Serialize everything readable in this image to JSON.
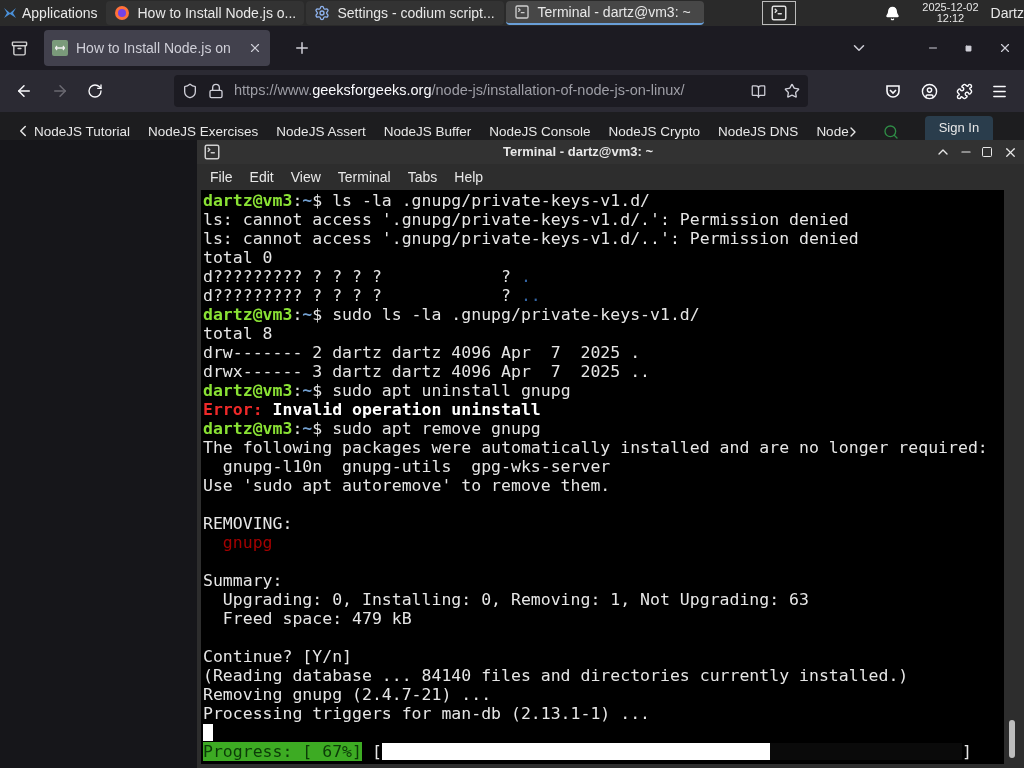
{
  "panel": {
    "apps_label": "Applications",
    "tasks": [
      {
        "kind": "browser",
        "title": "How to Install Node.js o...",
        "selected": false
      },
      {
        "kind": "settings",
        "title": "Settings - codium script...",
        "selected": false
      },
      {
        "kind": "terminal",
        "title": "Terminal - dartz@vm3: ~",
        "selected": true
      }
    ],
    "clock_date": "2025-12-02",
    "clock_time": "12:12",
    "user": "Dartz"
  },
  "browser": {
    "tab": {
      "title": "How to Install Node.js on"
    },
    "url": {
      "prefix": "https://www.",
      "domain": "geeksforgeeks.org",
      "path": "/node-js/installation-of-node-js-on-linux/"
    },
    "forward_disabled": true,
    "nav_links": [
      "NodeJS Tutorial",
      "NodeJS Exercises",
      "NodeJS Assert",
      "NodeJS Buffer",
      "NodeJS Console",
      "NodeJS Crypto",
      "NodeJS DNS",
      "Node"
    ],
    "sign_in": "Sign In"
  },
  "terminal": {
    "title": "Terminal - dartz@vm3: ~",
    "menu": [
      "File",
      "Edit",
      "View",
      "Terminal",
      "Tabs",
      "Help"
    ],
    "lines": [
      {
        "kind": "prompt",
        "user": "dartz@vm3",
        "sep": ":",
        "path": "~",
        "command": "$ ls -la .gnupg/private-keys-v1.d/"
      },
      {
        "kind": "text",
        "segments": [
          {
            "kind": "plain",
            "text": "ls: cannot access '.gnupg/private-keys-v1.d/.': Permission denied"
          }
        ]
      },
      {
        "kind": "text",
        "segments": [
          {
            "kind": "plain",
            "text": "ls: cannot access '.gnupg/private-keys-v1.d/..': Permission denied"
          }
        ]
      },
      {
        "kind": "text",
        "segments": [
          {
            "kind": "plain",
            "text": "total 0"
          }
        ]
      },
      {
        "kind": "text",
        "segments": [
          {
            "kind": "plain",
            "text": "d????????? ? ? ? ?            ? "
          },
          {
            "kind": "dir",
            "text": "."
          }
        ]
      },
      {
        "kind": "text",
        "segments": [
          {
            "kind": "plain",
            "text": "d????????? ? ? ? ?            ? "
          },
          {
            "kind": "dir",
            "text": ".."
          }
        ]
      },
      {
        "kind": "prompt",
        "user": "dartz@vm3",
        "sep": ":",
        "path": "~",
        "command": "$ sudo ls -la .gnupg/private-keys-v1.d/"
      },
      {
        "kind": "text",
        "segments": [
          {
            "kind": "plain",
            "text": "total 8"
          }
        ]
      },
      {
        "kind": "text",
        "segments": [
          {
            "kind": "plain",
            "text": "drw------- 2 dartz dartz 4096 Apr  7  2025 ."
          }
        ]
      },
      {
        "kind": "text",
        "segments": [
          {
            "kind": "plain",
            "text": "drwx------ 3 dartz dartz 4096 Apr  7  2025 .."
          }
        ]
      },
      {
        "kind": "prompt",
        "user": "dartz@vm3",
        "sep": ":",
        "path": "~",
        "command": "$ sudo apt uninstall gnupg"
      },
      {
        "kind": "text",
        "segments": [
          {
            "kind": "error",
            "text": "Error:"
          },
          {
            "kind": "bold",
            "text": " Invalid operation uninstall"
          }
        ]
      },
      {
        "kind": "prompt",
        "user": "dartz@vm3",
        "sep": ":",
        "path": "~",
        "command": "$ sudo apt remove gnupg"
      },
      {
        "kind": "text",
        "segments": [
          {
            "kind": "plain",
            "text": "The following packages were automatically installed and are no longer required:"
          }
        ]
      },
      {
        "kind": "text",
        "segments": [
          {
            "kind": "plain",
            "text": "  gnupg-l10n  gnupg-utils  gpg-wks-server"
          }
        ]
      },
      {
        "kind": "text",
        "segments": [
          {
            "kind": "plain",
            "text": "Use 'sudo apt autoremove' to remove them."
          }
        ]
      },
      {
        "kind": "blank"
      },
      {
        "kind": "text",
        "segments": [
          {
            "kind": "plain",
            "text": "REMOVING:"
          }
        ]
      },
      {
        "kind": "text",
        "segments": [
          {
            "kind": "removed",
            "text": "  gnupg"
          }
        ]
      },
      {
        "kind": "blank"
      },
      {
        "kind": "text",
        "segments": [
          {
            "kind": "plain",
            "text": "Summary:"
          }
        ]
      },
      {
        "kind": "text",
        "segments": [
          {
            "kind": "plain",
            "text": "  Upgrading: 0, Installing: 0, Removing: 1, Not Upgrading: 63"
          }
        ]
      },
      {
        "kind": "text",
        "segments": [
          {
            "kind": "plain",
            "text": "  Freed space: 479 kB"
          }
        ]
      },
      {
        "kind": "blank"
      },
      {
        "kind": "text",
        "segments": [
          {
            "kind": "plain",
            "text": "Continue? [Y/n]"
          }
        ]
      },
      {
        "kind": "text",
        "segments": [
          {
            "kind": "plain",
            "text": "(Reading database ... 84140 files and directories currently installed.)"
          }
        ]
      },
      {
        "kind": "text",
        "segments": [
          {
            "kind": "plain",
            "text": "Removing gnupg (2.4.7-21) ..."
          }
        ]
      },
      {
        "kind": "text",
        "segments": [
          {
            "kind": "plain",
            "text": "Processing triggers for man-db (2.13.1-1) ..."
          }
        ]
      },
      {
        "kind": "cursor"
      }
    ],
    "progress": {
      "label": "Progress: [ 67%]",
      "open": "[",
      "close": "]",
      "level": 0.67
    }
  }
}
